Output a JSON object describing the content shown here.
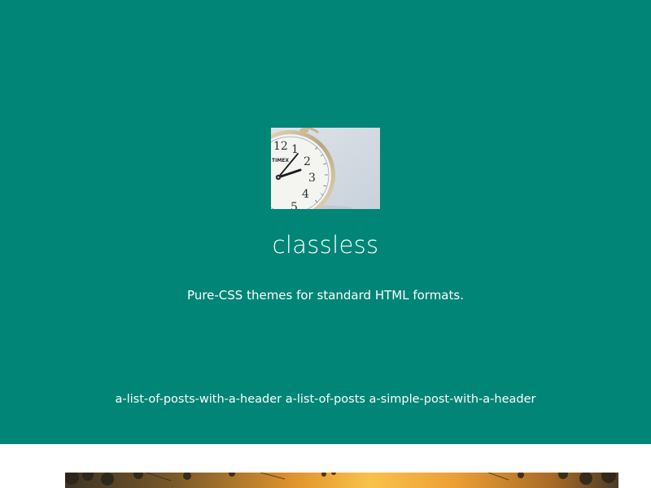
{
  "header": {
    "logo": {
      "alt": "alarm clock",
      "clock_numerals": [
        "12",
        "1",
        "2",
        "3",
        "4",
        "5"
      ],
      "brand": "TIMEX"
    },
    "title": "classless",
    "tagline": "Pure-CSS themes for standard HTML formats."
  },
  "nav": {
    "links": [
      "a-list-of-posts-with-a-header",
      "a-list-of-posts",
      "a-simple-post-with-a-header"
    ]
  },
  "colors": {
    "header_bg": "#008577",
    "text": "#ffffff",
    "page_bg": "#ffffff"
  },
  "post": {
    "image_alt": "sunset through trees"
  }
}
